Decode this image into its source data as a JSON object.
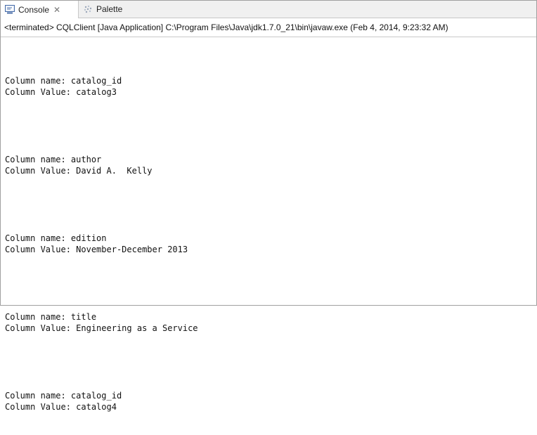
{
  "tabs": {
    "console_label": "Console",
    "close_symbol": "✕",
    "palette_label": "Palette"
  },
  "status": {
    "text": "<terminated> CQLClient [Java Application] C:\\Program Files\\Java\\jdk1.7.0_21\\bin\\javaw.exe (Feb 4, 2014, 9:23:32 AM)"
  },
  "output": {
    "blocks": [
      {
        "name_line": "Column name: catalog_id",
        "value_line": "Column Value: catalog3"
      },
      {
        "name_line": "Column name: author",
        "value_line": "Column Value: David A.  Kelly"
      },
      {
        "name_line": "Column name: edition",
        "value_line": "Column Value: November-December 2013"
      },
      {
        "name_line": "Column name: title",
        "value_line": "Column Value: Engineering as a Service"
      },
      {
        "name_line": "Column name: catalog_id",
        "value_line": "Column Value: catalog4"
      }
    ]
  },
  "icons": {
    "console": "console-icon",
    "palette": "palette-icon",
    "close": "close-icon"
  },
  "colors": {
    "tab_bar_bg": "#f0f0f0",
    "border": "#c8c8c8",
    "console_icon_blue": "#4a6ea9"
  }
}
